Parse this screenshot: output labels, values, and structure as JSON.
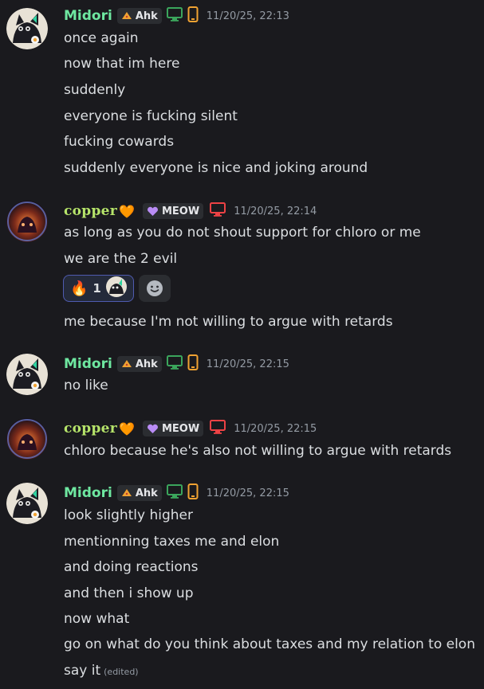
{
  "icons": {
    "tag_midori": "pizza-slice-icon",
    "tag_copper": "purple-heart-icon",
    "desktop": "desktop-icon",
    "mobile": "mobile-icon",
    "fire": "fire-emoji",
    "add_reaction": "smile-plus-icon"
  },
  "colors": {
    "midori_name": "#6ee7a0",
    "copper_name": "#b6e46a",
    "desktop_green": "#3ba55c",
    "mobile_orange": "#f0a232",
    "desktop_red": "#ed4245"
  },
  "messages": [
    {
      "author": "Midori",
      "tag": "Ahk",
      "timestamp": "11/20/25, 22:13",
      "lines": [
        "once again",
        "now that im here",
        "suddenly",
        "everyone is fucking silent",
        "fucking cowards",
        "suddenly everyone is nice and joking around"
      ]
    },
    {
      "author": "copper",
      "author_emoji": "🧡",
      "tag": "MEOW",
      "timestamp": "11/20/25, 22:14",
      "lines": [
        "as long as you do not shout support for chloro or me",
        "we are the 2 evil"
      ],
      "reaction": {
        "emoji": "🔥",
        "count": "1"
      },
      "after_lines": [
        "me because I'm not willing to argue with retards"
      ]
    },
    {
      "author": "Midori",
      "tag": "Ahk",
      "timestamp": "11/20/25, 22:15",
      "lines": [
        "no like"
      ]
    },
    {
      "author": "copper",
      "author_emoji": "🧡",
      "tag": "MEOW",
      "timestamp": "11/20/25, 22:15",
      "lines": [
        "chloro because he's also not willing to argue with retards"
      ]
    },
    {
      "author": "Midori",
      "tag": "Ahk",
      "timestamp": "11/20/25, 22:15",
      "lines": [
        "look slightly higher",
        "mentionning taxes me and elon",
        "and doing reactions",
        "and then i show up",
        "now what",
        "go on what do you think about taxes and my relation to elon",
        "say it"
      ],
      "edited_label": "(edited)"
    }
  ]
}
